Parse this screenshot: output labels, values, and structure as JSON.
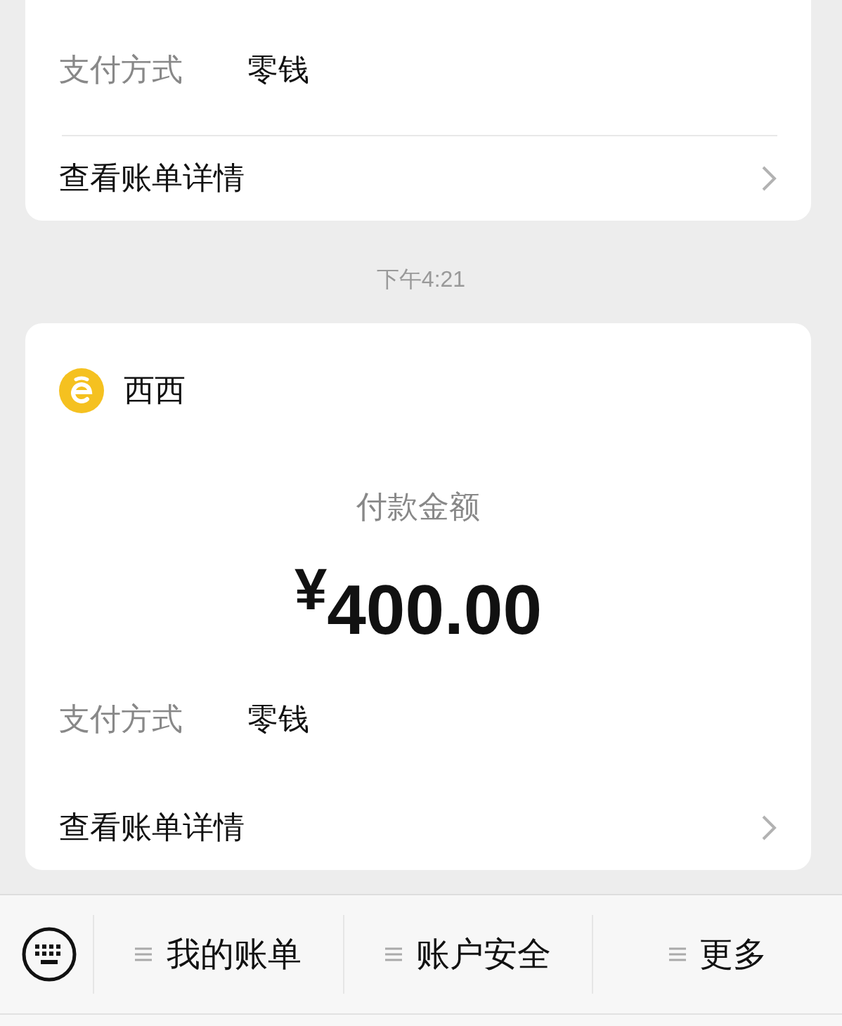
{
  "feed": [
    {
      "kind": "card",
      "pay_label": "支付方式",
      "pay_method": "零钱",
      "details": "查看账单详情",
      "divider": true
    },
    {
      "kind": "time",
      "text": "下午4:21"
    },
    {
      "kind": "card",
      "merchant": "西西",
      "amount_label": "付款金额",
      "amount": "$^{¥}$400.00",
      "pay_label": "支付方式",
      "pay_method": "零钱",
      "details": "查看账单详情",
      "divider": false
    }
  ],
  "bottom_menu": [
    "我的账单",
    "账户安全",
    "更多"
  ]
}
